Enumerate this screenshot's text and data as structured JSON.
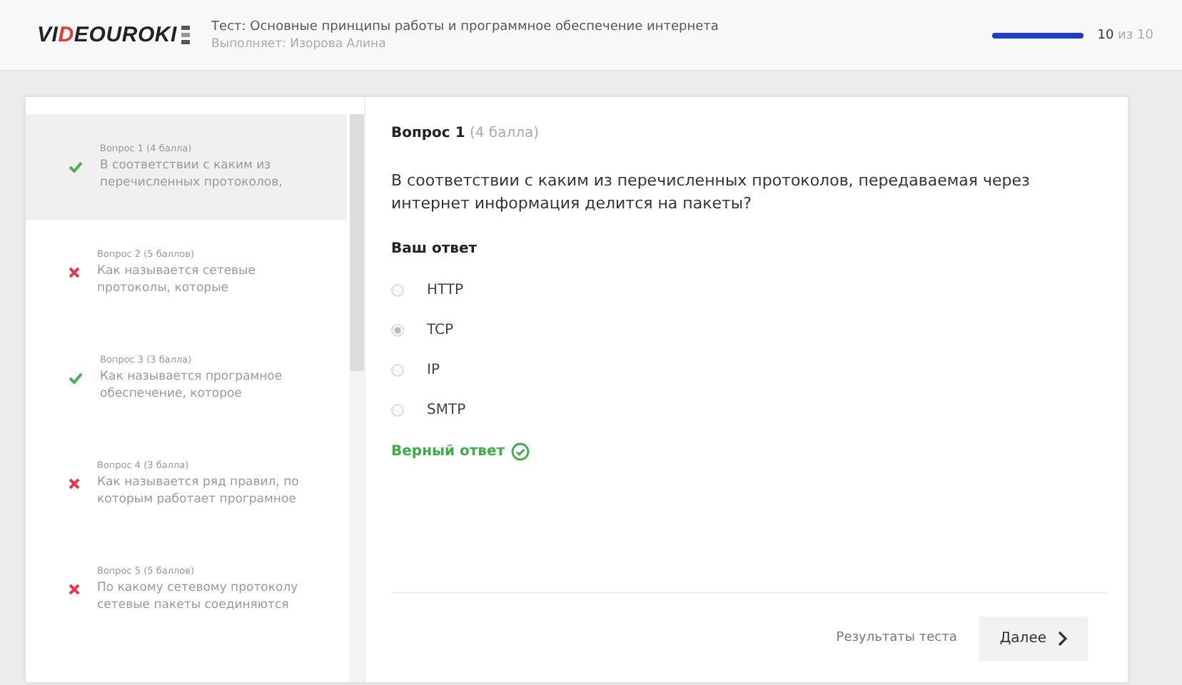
{
  "header": {
    "logo": [
      {
        "text": "VI",
        "accent": false
      },
      {
        "text": "D",
        "accent": true
      },
      {
        "text": "EOUROKI",
        "accent": false
      }
    ],
    "test_title": "Тест: Основные принципы работы и программное обеспечение интернета",
    "performer": "Выполняет: Изорова Алина",
    "progress": {
      "level": 1,
      "reading": "**10** из 10"
    }
  },
  "sidebar": {
    "items": [
      {
        "title": "Вопрос 1 (4 балла)",
        "text": "В соответствии с каким из перечисленных протоколов,",
        "correct": true,
        "selected": true
      },
      {
        "title": "Вопрос 2 (5 баллов)",
        "text": "Как называется сетевые протоколы, которые",
        "correct": false,
        "selected": false
      },
      {
        "title": "Вопрос 3 (3 балла)",
        "text": "Как называется програмное обеспечение, которое",
        "correct": true,
        "selected": false
      },
      {
        "title": "Вопрос 4 (3 балла)",
        "text": "Как называется ряд правил, по которым работает програмное",
        "correct": false,
        "selected": false
      },
      {
        "title": "Вопрос 5 (5 баллов)",
        "text": "По какому сетевому протоколу сетевые пакеты соединяются",
        "correct": false,
        "selected": false
      }
    ]
  },
  "question": {
    "number": "Вопрос 1",
    "points": "(4 балла)",
    "text": "В соответствии с каким из перечисленных протоколов, передаваемая через интернет информация делится на пакеты?",
    "answer_label": "Ваш ответ",
    "options": [
      {
        "label": "HTTP",
        "selected": false
      },
      {
        "label": "TCP",
        "selected": true
      },
      {
        "label": "IP",
        "selected": false
      },
      {
        "label": "SMTP",
        "selected": false
      }
    ],
    "result": {
      "text": "Верный ответ",
      "correct": true
    }
  },
  "footer": {
    "results_link": "Результаты теста",
    "next_button": "Далее"
  }
}
